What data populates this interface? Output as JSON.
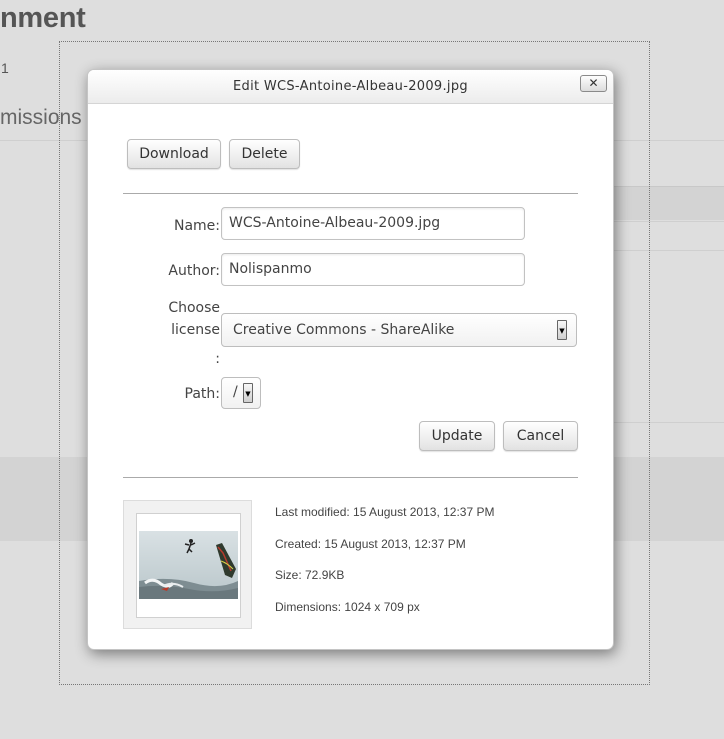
{
  "background": {
    "heading": "nment",
    "small_text": "1",
    "subheading": "missions"
  },
  "dialog": {
    "title": "Edit WCS-Antoine-Albeau-2009.jpg",
    "close_glyph": "✕",
    "buttons": {
      "download": "Download",
      "delete": "Delete",
      "update": "Update",
      "cancel": "Cancel"
    },
    "form": {
      "name_label": "Name:",
      "name_value": "WCS-Antoine-Albeau-2009.jpg",
      "author_label": "Author:",
      "author_value": "Nolispanmo",
      "license_label_line1": "Choose",
      "license_label_line2": "license",
      "license_label_line3": ":",
      "license_value": "Creative Commons - ShareAlike",
      "path_label": "Path:",
      "path_value": "/"
    },
    "details": {
      "last_modified": "Last modified: 15 August 2013, 12:37 PM",
      "created": "Created: 15 August 2013, 12:37 PM",
      "size": "Size: 72.9KB",
      "dimensions": "Dimensions: 1024 x 709 px"
    }
  },
  "colors": {
    "page_background": "#dedede",
    "dialog_background": "#ffffff",
    "sky": "#c9d4d8",
    "sea": "#7e8d92"
  }
}
